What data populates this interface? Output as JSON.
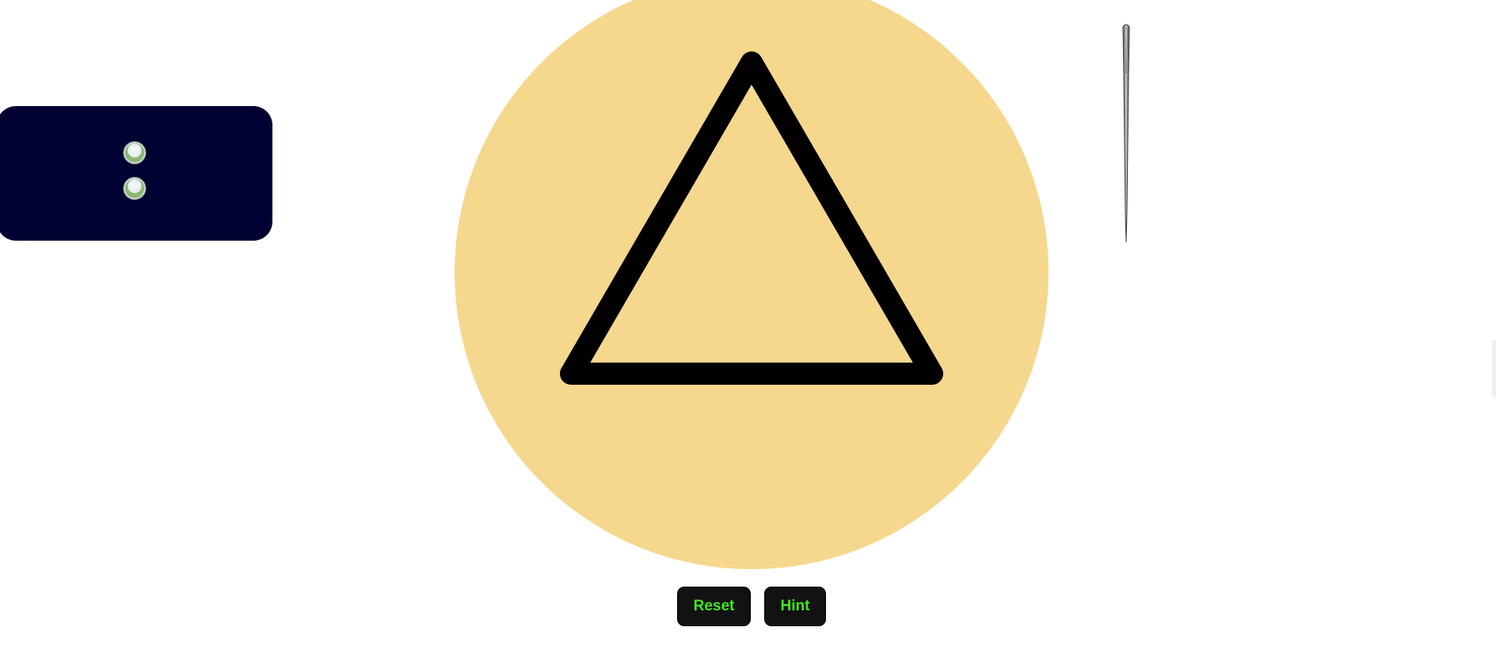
{
  "panel": {
    "background": "#000033",
    "options": [
      {
        "icon": "marble-icon"
      },
      {
        "icon": "marble-icon"
      }
    ]
  },
  "board": {
    "background_color": "#f5d78e",
    "shape": "triangle",
    "outline_color": "#000000"
  },
  "tool": {
    "icon": "needle-icon"
  },
  "controls": {
    "reset_label": "Reset",
    "hint_label": "Hint",
    "label_color": "#3ee81f",
    "button_color": "#121212"
  }
}
